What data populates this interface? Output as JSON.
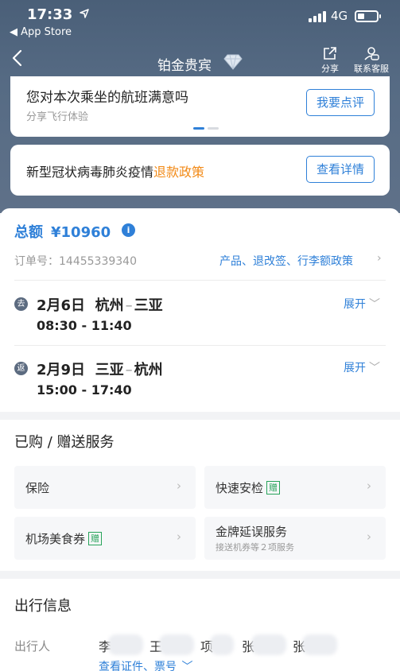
{
  "status_bar": {
    "time": "17:33",
    "back_app": "◀ App Store",
    "network": "4G"
  },
  "nav": {
    "title": "铂金贵宾",
    "share_label": "分享",
    "service_label": "联系客服"
  },
  "rating_card": {
    "title": "您对本次乘坐的航班满意吗",
    "subtitle": "分享飞行体验",
    "button": "我要点评"
  },
  "covid_card": {
    "text": "新型冠状病毒肺炎疫情",
    "link": "退款政策",
    "button": "查看详情"
  },
  "order": {
    "total_label": "总额",
    "total_amount": "¥10960",
    "order_no": "订单号：14455339340",
    "policy_link": "产品、退改签、行李额政策",
    "legs": [
      {
        "tag": "去",
        "date": "2月6日",
        "from": "杭州",
        "to": "三亚",
        "time": "08:30 - 11:40",
        "expand": "展开"
      },
      {
        "tag": "返",
        "date": "2月9日",
        "from": "三亚",
        "to": "杭州",
        "time": "15:00 - 17:40",
        "expand": "展开"
      }
    ]
  },
  "services": {
    "title": "已购 / 赠送服务",
    "gift_tag": "赠",
    "items": [
      {
        "label": "保险",
        "sub": ""
      },
      {
        "label": "快速安检",
        "sub": ""
      },
      {
        "label": "机场美食券",
        "sub": ""
      },
      {
        "label": "金牌延误服务",
        "sub": "接送机券等２项服务"
      }
    ]
  },
  "trip": {
    "title": "出行信息",
    "label": "出行人",
    "passengers": [
      "李",
      "王",
      "项",
      "张",
      "张"
    ],
    "view_docs": "查看证件、票号"
  },
  "colors": {
    "accent": "#2f80d8",
    "orange_link": "#f28a17",
    "header_bg": "#566b84",
    "gift_green": "#27a35a"
  }
}
